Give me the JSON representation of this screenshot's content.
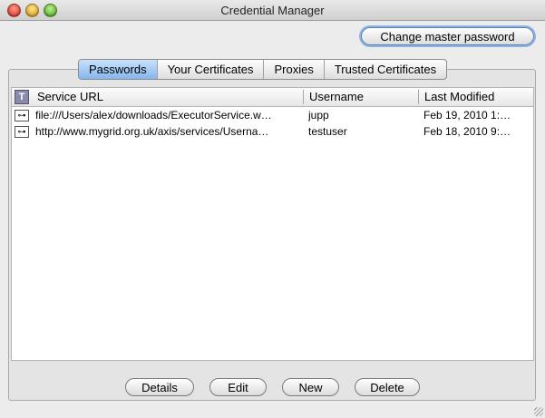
{
  "window": {
    "title": "Credential Manager"
  },
  "toolbar": {
    "change_master_password": "Change master password"
  },
  "tabs": [
    {
      "label": "Passwords",
      "active": true
    },
    {
      "label": "Your Certificates",
      "active": false
    },
    {
      "label": "Proxies",
      "active": false
    },
    {
      "label": "Trusted Certificates",
      "active": false
    }
  ],
  "table": {
    "corner_icon": "filter-icon",
    "columns": [
      "Service URL",
      "Username",
      "Last Modified"
    ],
    "rows": [
      {
        "icon": "key-icon",
        "url": "file:///Users/alex/downloads/ExecutorService.w…",
        "username": "jupp",
        "modified": "Feb 19, 2010 1:…"
      },
      {
        "icon": "key-icon",
        "url": "http://www.mygrid.org.uk/axis/services/Userna…",
        "username": "testuser",
        "modified": "Feb 18, 2010 9:…"
      }
    ]
  },
  "buttons": {
    "details": "Details",
    "edit": "Edit",
    "new": "New",
    "delete": "Delete"
  }
}
